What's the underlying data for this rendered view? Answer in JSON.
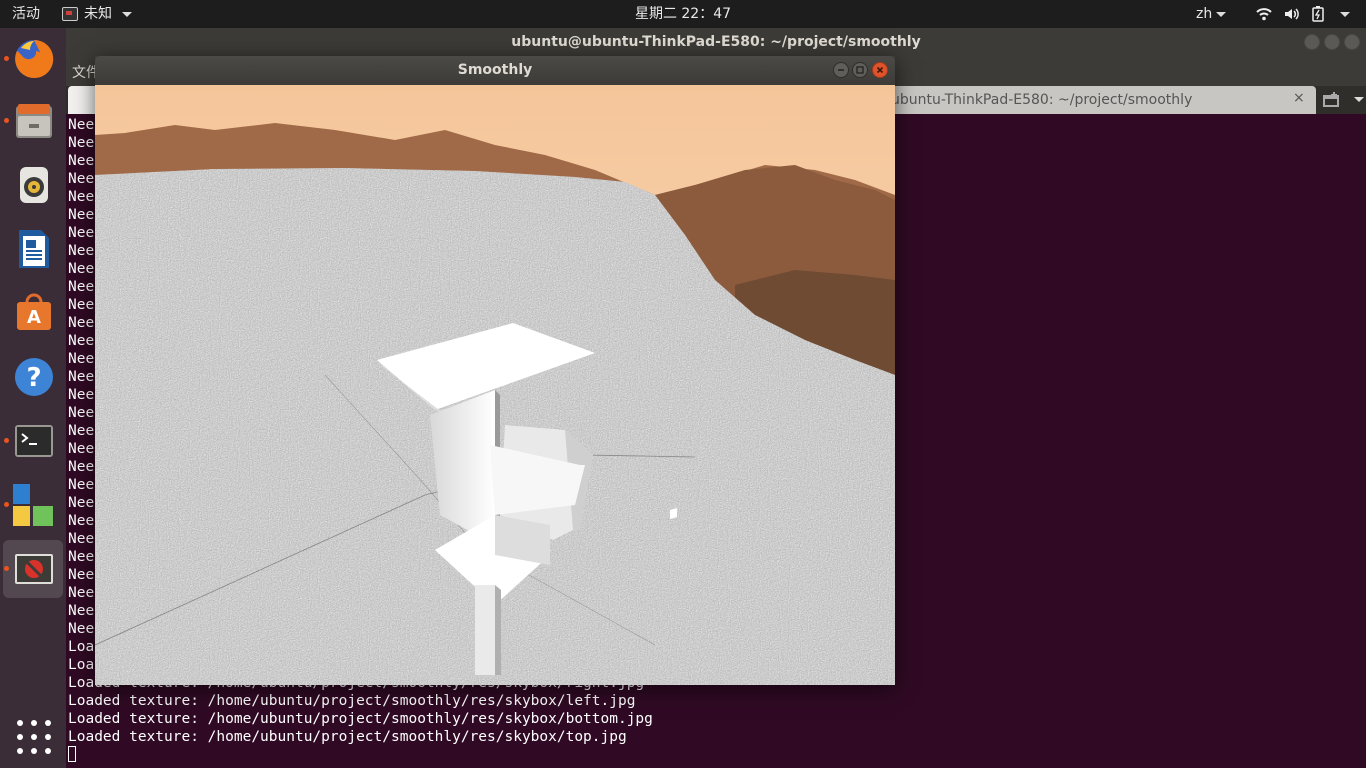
{
  "topbar": {
    "activities": "活动",
    "app_menu": "未知",
    "clock": "星期二 22：47",
    "input_method": "zh"
  },
  "dock": {
    "items": [
      {
        "name": "firefox",
        "icon": "firefox-icon",
        "running": true
      },
      {
        "name": "files",
        "icon": "files-icon",
        "running": true
      },
      {
        "name": "rhythmbox",
        "icon": "speaker-icon",
        "running": false
      },
      {
        "name": "libreoffice-writer",
        "icon": "writer-icon",
        "running": false
      },
      {
        "name": "ubuntu-software",
        "icon": "software-store-icon",
        "running": false
      },
      {
        "name": "help",
        "icon": "help-icon",
        "running": false
      },
      {
        "name": "terminal",
        "icon": "terminal-icon",
        "running": true
      },
      {
        "name": "unknown-app",
        "icon": "blocks-icon",
        "running": true
      },
      {
        "name": "smoothly",
        "icon": "no-entry-icon",
        "running": true,
        "active": true
      },
      {
        "name": "show-applications",
        "icon": "grid-icon",
        "running": false
      }
    ]
  },
  "terminal": {
    "title": "ubuntu@ubuntu-ThinkPad-E580: ~/project/smoothly",
    "menu_file": "文件",
    "tab_label": "ubuntu-ThinkPad-E580: ~/project/smoothly",
    "tab_close": "×",
    "lines": [
      "Nee",
      "Nee",
      "Nee",
      "Nee",
      "Nee",
      "Nee",
      "Nee",
      "Nee",
      "Nee",
      "Nee",
      "Nee",
      "Nee",
      "Nee",
      "Nee",
      "Nee",
      "Nee",
      "Nee",
      "Nee",
      "Nee",
      "Nee",
      "Nee",
      "Nee",
      "Nee",
      "Nee",
      "Nee",
      "Nee",
      "Nee",
      "Nee",
      "Nee",
      "Load",
      "Load",
      "Loaded texture: /home/ubuntu/project/smoothly/res/skybox/right.jpg",
      "Loaded texture: /home/ubuntu/project/smoothly/res/skybox/left.jpg",
      "Loaded texture: /home/ubuntu/project/smoothly/res/skybox/bottom.jpg",
      "Loaded texture: /home/ubuntu/project/smoothly/res/skybox/top.jpg"
    ]
  },
  "smoothly": {
    "title": "Smoothly"
  },
  "colors": {
    "terminal_bg": "#300a24",
    "ubuntu_orange": "#e95420",
    "close_red": "#e0532a",
    "sky_top": "#f7c799",
    "terrain": "#c9c9c9"
  }
}
